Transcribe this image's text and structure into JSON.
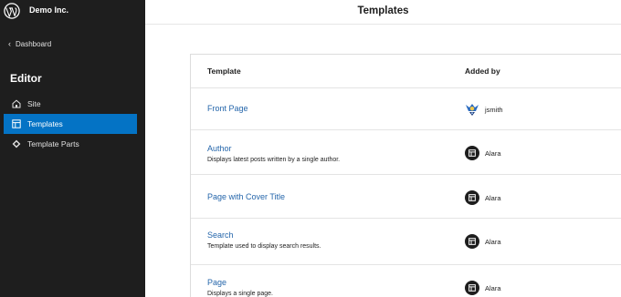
{
  "site": {
    "name": "Demo Inc."
  },
  "sidebar": {
    "back_label": "Dashboard",
    "section_title": "Editor",
    "items": [
      {
        "label": "Site",
        "icon": "home-icon",
        "active": false
      },
      {
        "label": "Templates",
        "icon": "layout-icon",
        "active": true
      },
      {
        "label": "Template Parts",
        "icon": "symbol-filled-icon",
        "active": false
      }
    ]
  },
  "header": {
    "title": "Templates"
  },
  "table": {
    "columns": [
      "Template",
      "Added by"
    ],
    "rows": [
      {
        "title": "Front Page",
        "description": "",
        "added_by": "jsmith",
        "added_by_icon": "user-avatar"
      },
      {
        "title": "Author",
        "description": "Displays latest posts written by a single author.",
        "added_by": "Alara",
        "added_by_icon": "layout-icon"
      },
      {
        "title": "Page with Cover Title",
        "description": "",
        "added_by": "Alara",
        "added_by_icon": "layout-icon"
      },
      {
        "title": "Search",
        "description": "Template used to display search results.",
        "added_by": "Alara",
        "added_by_icon": "layout-icon"
      },
      {
        "title": "Page",
        "description": "Displays a single page.",
        "added_by": "Alara",
        "added_by_icon": "layout-icon"
      }
    ]
  },
  "colors": {
    "sidebar_bg": "#1e1e1e",
    "accent": "#0473c5",
    "link": "#2566ab"
  }
}
